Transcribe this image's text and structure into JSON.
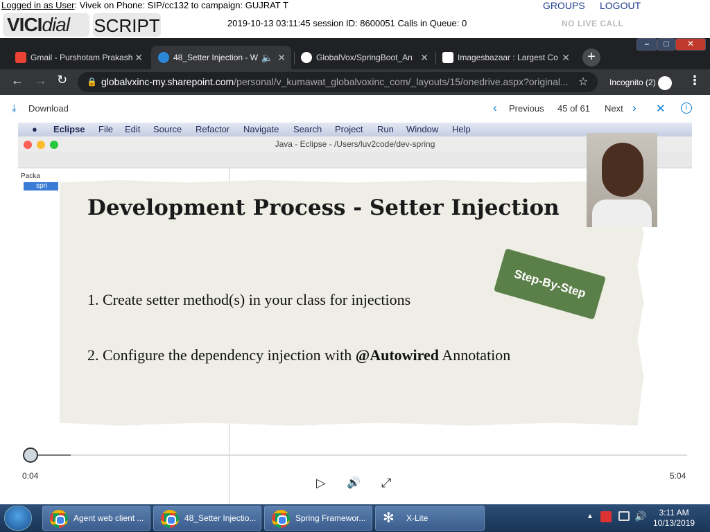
{
  "vicidial": {
    "login_prefix": "Logged in as User",
    "login_rest": ": Vivek on Phone: SIP/cc132  to campaign: GUJRAT  T",
    "groups": "GROUPS",
    "logout": "LOGOUT",
    "logo_vici": "VICI",
    "logo_dial": "dial",
    "script_tab": "SCRIPT",
    "session_line": "2019-10-13 03:11:45   session ID: 8600051   Calls in Queue: 0",
    "no_live_call": "NO LIVE CALL"
  },
  "browser": {
    "tabs": [
      {
        "label": "Gmail - Purshotam Prakash",
        "icon_color": "#ea4335"
      },
      {
        "label": "48_Setter Injection - W",
        "icon_color": "#2b88d8"
      },
      {
        "label": "GlobalVox/SpringBoot_An",
        "icon_color": "#ffffff"
      },
      {
        "label": "Imagesbazaar : Largest Co",
        "icon_color": "#ffffff"
      }
    ],
    "url_host": "globalvxinc-my.sharepoint.com",
    "url_path": "/personal/v_kumawat_globalvoxinc_com/_layouts/15/onedrive.aspx?original...",
    "incognito": "Incognito (2)"
  },
  "viewer": {
    "download": "Download",
    "previous": "Previous",
    "page": "45 of 61",
    "next": "Next"
  },
  "eclipse": {
    "menu": [
      "Eclipse",
      "File",
      "Edit",
      "Source",
      "Refactor",
      "Navigate",
      "Search",
      "Project",
      "Run",
      "Window",
      "Help"
    ],
    "window_title": "Java - Eclipse - /Users/luv2code/dev-spring",
    "pkg_tab": "Packa",
    "tree_item": "spri"
  },
  "slide": {
    "title": "Development Process - Setter Injection",
    "badge": "Step-By-Step",
    "step1": "1.  Create setter method(s) in your class for injections",
    "step2_pre": "2.  Configure the dependency injection with ",
    "step2_bold": "@Autowired",
    "step2_post": " Annotation"
  },
  "player": {
    "current_time": "0:04",
    "end_time": "5:04",
    "progress": 0.013
  },
  "taskbar": {
    "items": [
      "Agent web client ...",
      "48_Setter Injectio...",
      "Spring Framewor...",
      "X-Lite"
    ],
    "time": "3:11 AM",
    "date": "10/13/2019"
  }
}
